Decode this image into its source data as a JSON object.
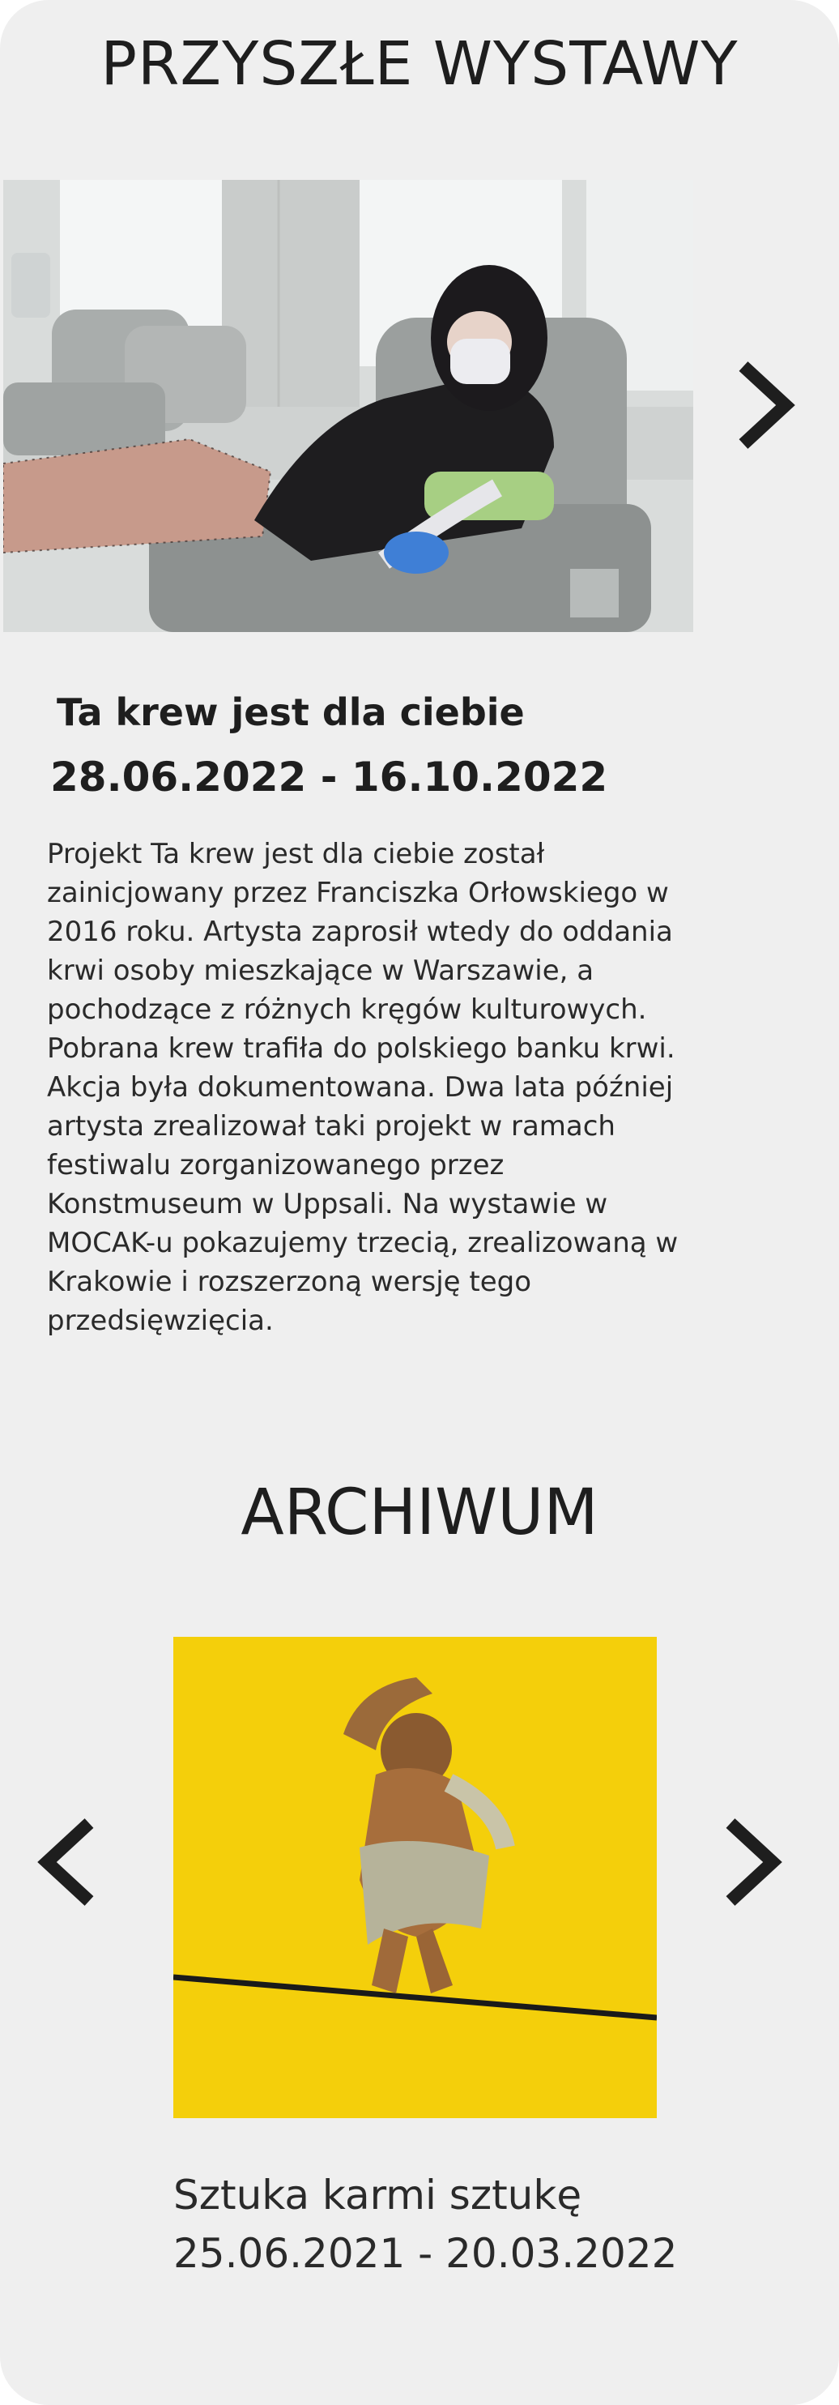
{
  "future": {
    "heading": "PRZYSZŁE WYSTAWY",
    "exhibition": {
      "title": "Ta krew jest dla ciebie",
      "dates": "28.06.2022 - 16.10.2022",
      "description": "Projekt Ta krew jest dla ciebie został zainicjowany przez Franciszka Orłowskiego w 2016 roku. Artysta zaprosił wtedy do oddania krwi osoby mieszkające w Warszawie, a pochodzące z różnych kręgów kulturowych. Pobrana krew trafiła do polskiego banku krwi. Akcja była dokumentowana. Dwa lata później artysta zrealizował taki projekt w ramach festiwalu zorganizowanego przez Konstmuseum w Uppsali. Na wystawie w MOCAK-u pokazujemy trzecią, zrealizowaną w Krakowie i rozszerzoną wersję tego przedsięwzięcia."
    },
    "next_icon": "chevron-right-icon"
  },
  "archive": {
    "heading": "ARCHIWUM",
    "exhibition": {
      "title": "Sztuka karmi sztukę",
      "dates": "25.06.2021 - 20.03.2022"
    },
    "prev_icon": "chevron-left-icon",
    "next_icon": "chevron-right-icon"
  },
  "colors": {
    "background": "#efefef",
    "text": "#1e1e1e",
    "art_yellow": "#f4cf0b"
  }
}
